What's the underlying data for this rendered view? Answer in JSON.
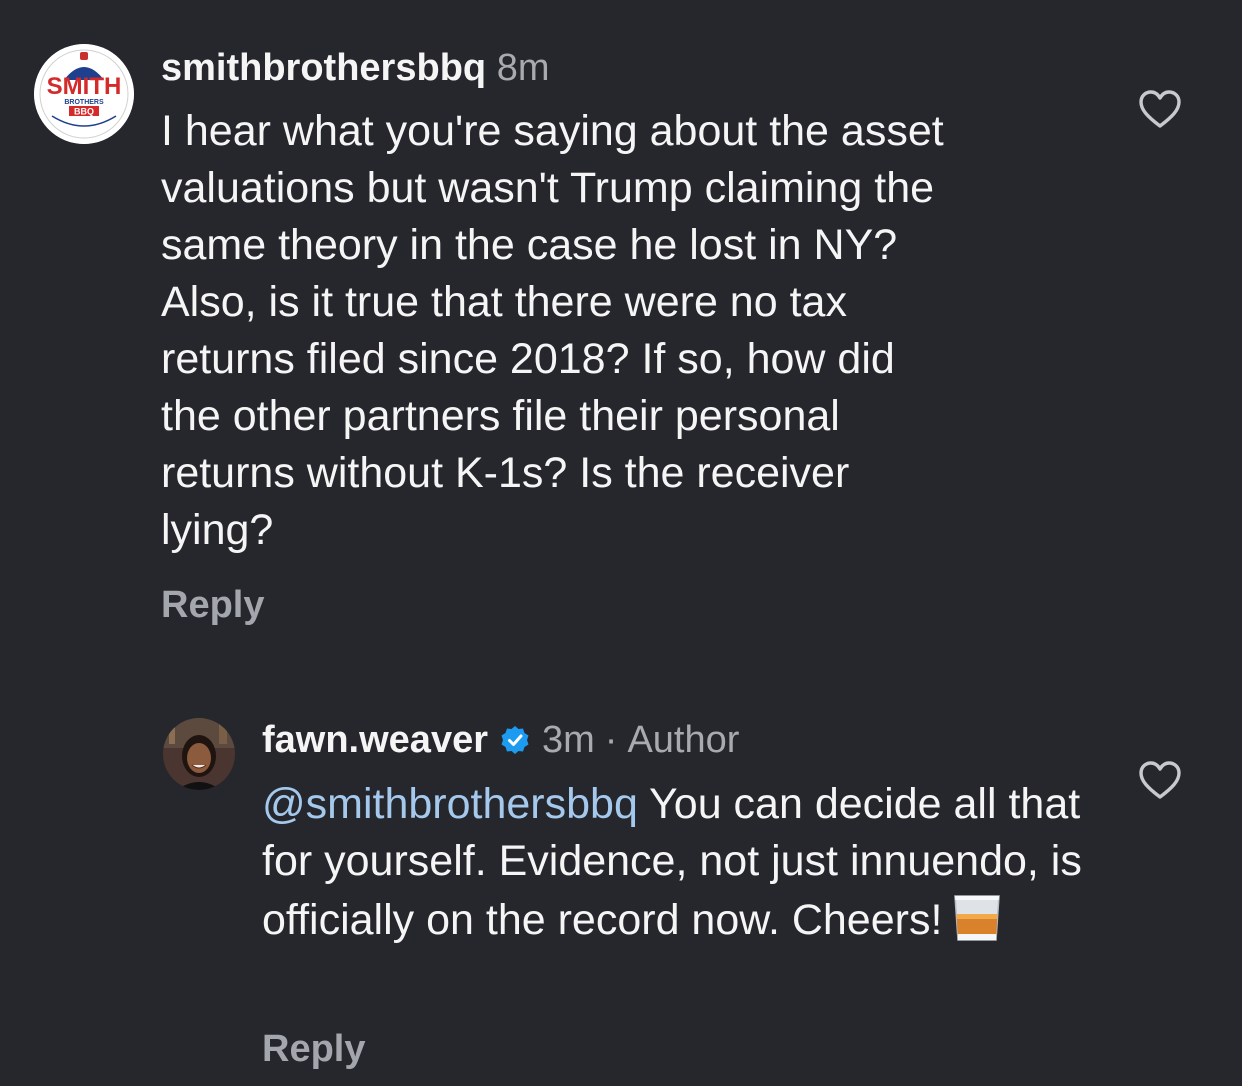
{
  "comments": [
    {
      "username": "smithbrothersbbq",
      "time": "8m",
      "avatar_icon": "smith-brothers-bbq-logo",
      "logo_text": "SMITH",
      "logo_subtext": "BROTHERS",
      "logo_bbq": "BBQ",
      "body": "I hear what you're saying about the asset\nvaluations but wasn't Trump claiming the\nsame theory in the case he lost in NY?\nAlso, is it true that there were no tax\nreturns filed since 2018? If so, how did\nthe other partners file their personal\nreturns without K-1s?  Is the receiver\nlying?",
      "reply_label": "Reply",
      "like_icon": "heart-icon"
    },
    {
      "username": "fawn.weaver",
      "verified_icon": "verified-badge-icon",
      "time": "3m",
      "separator": "·",
      "author_label": "Author",
      "mention": "@smithbrothersbbq",
      "body": "You can decide all that for yourself. Evidence, not just innuendo, is officially on the record now. Cheers!",
      "emoji": "tumbler-glass-emoji",
      "reply_label": "Reply",
      "like_icon": "heart-icon"
    }
  ],
  "colors": {
    "background": "#25272d",
    "text": "#f5f5f5",
    "meta": "#a8aab0",
    "mention": "#a5c9ec",
    "verified": "#1d9bf0"
  }
}
